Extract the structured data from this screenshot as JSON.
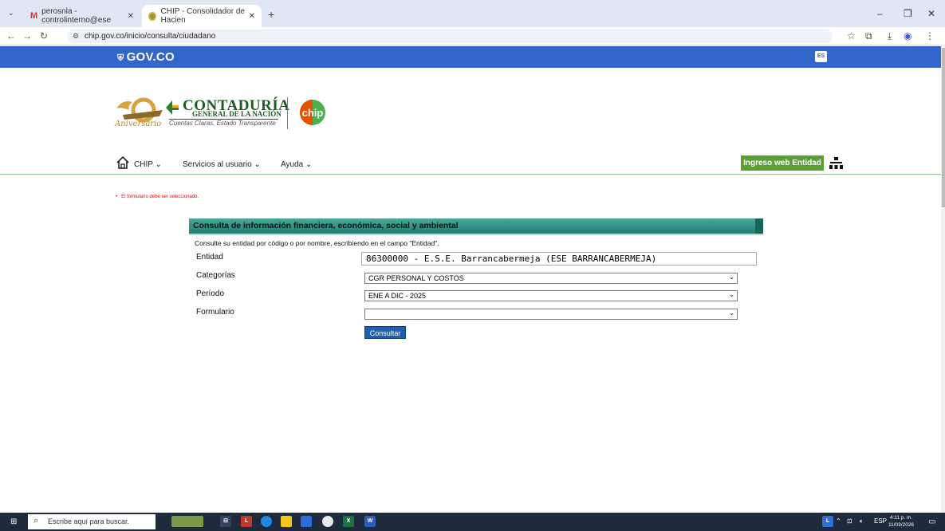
{
  "browser": {
    "tabs": [
      {
        "title": "perosnla - controlinterno@ese",
        "active": false
      },
      {
        "title": "CHIP - Consolidador de Hacien",
        "active": true
      }
    ],
    "url": "chip.gov.co/inicio/consulta/ciudadano",
    "new_tab": "+",
    "tab_close": "✕"
  },
  "govbar": {
    "logo": "GOV.CO",
    "lang": "ES"
  },
  "header": {
    "cgn_title": "CONTADURÍA",
    "cgn_subtitle": "GENERAL DE LA NACIÓN",
    "cgn_tagline": "Cuentas Claras, Estado Transparente",
    "anniversary": "Aniversario",
    "anniversary_number": "30"
  },
  "nav": {
    "items": [
      {
        "label": "CHIP ⌄"
      },
      {
        "label": "Servicios al usuario ⌄"
      },
      {
        "label": "Ayuda ⌄"
      }
    ],
    "login_button": "Ingreso web Entidad"
  },
  "error": {
    "message": "El formulario debe ser seleccionado."
  },
  "form": {
    "panel_title": "Consulta de información financiera, económica, social y ambiental",
    "instructions": "Consulte su entidad por código o por nombre, escribiendo en el campo \"Entidad\".",
    "entidad_label": "Entidad",
    "entidad_value": "86300000 - E.S.E. Barrancabermeja (ESE BARRANCABERMEJA)",
    "categorias_label": "Categorías",
    "categorias_value": "CGR PERSONAL Y COSTOS",
    "periodo_label": "Período",
    "periodo_value": "ENE A DIC - 2025",
    "formulario_label": "Formulario",
    "formulario_value": "",
    "submit_label": "Consultar"
  },
  "taskbar": {
    "search_placeholder": "Escribe aquí para buscar.",
    "time": "4:11 p. m.",
    "date": "11/03/2026",
    "lang": "ESP"
  },
  "colors": {
    "gov_blue": "#3366cc",
    "green_button": "#5aa032",
    "panel_teal": "#1e7f73",
    "submit_blue": "#1f5fb0",
    "error_red": "#e00000"
  }
}
